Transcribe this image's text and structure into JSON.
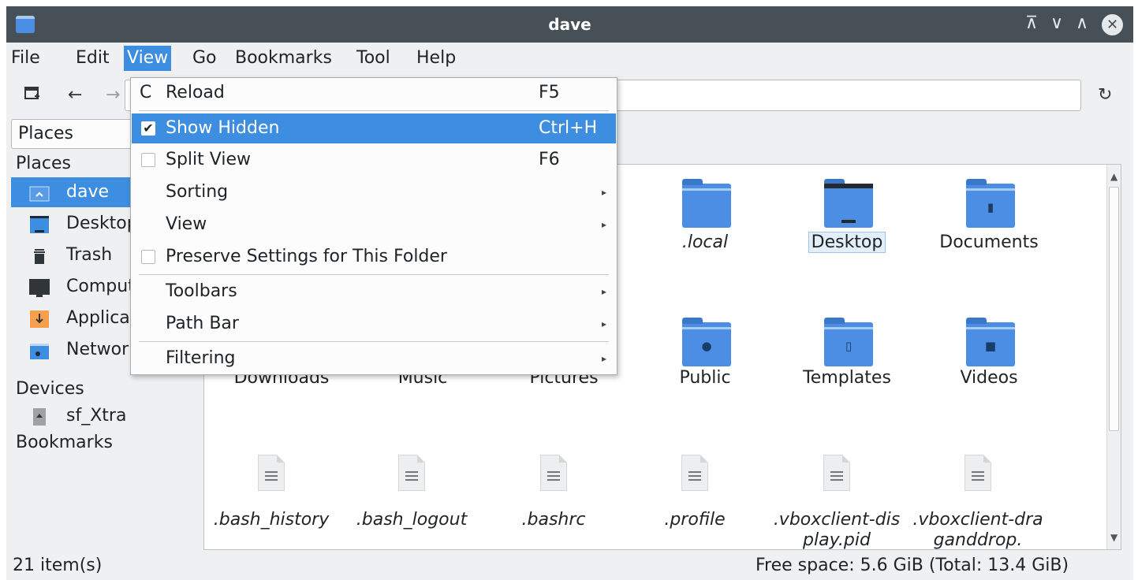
{
  "window": {
    "title": "dave",
    "controls": {
      "keep_above": "⊼",
      "minimize": "∨",
      "maximize": "∧",
      "close": "✕"
    }
  },
  "menubar": {
    "file": "File",
    "edit": "Edit",
    "view": "View",
    "go": "Go",
    "bookmarks": "Bookmarks",
    "tool": "Tool",
    "help": "Help"
  },
  "toolbar": {
    "new_tab_icon": "new-tab-icon",
    "back": "←",
    "forward": "→",
    "jump": "↻"
  },
  "places_combo": "Places",
  "sidebar": {
    "places_header": "Places",
    "places": [
      {
        "label": "dave",
        "icon": "home-icon"
      },
      {
        "label": "Desktop",
        "icon": "desktop-icon"
      },
      {
        "label": "Trash",
        "icon": "trash-icon"
      },
      {
        "label": "Computer",
        "icon": "computer-icon"
      },
      {
        "label": "Applications",
        "icon": "applications-icon"
      },
      {
        "label": "Network",
        "icon": "network-icon"
      }
    ],
    "devices_header": "Devices",
    "devices": [
      {
        "label": "sf_Xtra",
        "icon": "drive-icon"
      }
    ],
    "bookmarks_header": "Bookmarks"
  },
  "files": {
    "row1": [
      ".local",
      "Desktop",
      "Documents"
    ],
    "row2": [
      "Downloads",
      "Music",
      "Pictures",
      "Public",
      "Templates",
      "Videos"
    ],
    "row3": [
      ".bash_history",
      ".bash_logout",
      ".bashrc",
      ".profile",
      ".vboxclient-display.pid",
      ".vboxclient-draganddrop."
    ]
  },
  "view_menu": {
    "reload": {
      "label": "Reload",
      "shortcut": "F5"
    },
    "show_hidden": {
      "label": "Show Hidden",
      "shortcut": "Ctrl+H",
      "checked": true
    },
    "split_view": {
      "label": "Split View",
      "shortcut": "F6",
      "checked": false
    },
    "sorting": {
      "label": "Sorting"
    },
    "view": {
      "label": "View"
    },
    "preserve": {
      "label": "Preserve Settings for This Folder",
      "checked": false
    },
    "toolbars": {
      "label": "Toolbars"
    },
    "path_bar": {
      "label": "Path Bar"
    },
    "filtering": {
      "label": "Filtering"
    }
  },
  "status": {
    "items": "21 item(s)",
    "free_space": "Free space: 5.6 GiB (Total: 13.4 GiB)"
  },
  "colors": {
    "accent": "#3d8ee0",
    "titlebar": "#475057",
    "folder": "#4b8ee4"
  }
}
